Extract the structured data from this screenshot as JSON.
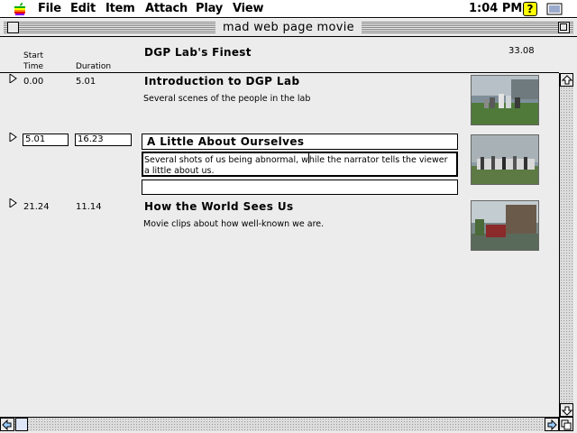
{
  "menubar": {
    "items": [
      "File",
      "Edit",
      "Item",
      "Attach",
      "Play",
      "View"
    ],
    "clock": "1:04 PM",
    "help_icon": "?"
  },
  "window": {
    "title": "mad web page movie"
  },
  "header": {
    "start_label": "Start\nTime",
    "duration_label": "Duration",
    "movie_title": "DGP Lab's Finest",
    "movie_length": "33.08"
  },
  "scenes": [
    {
      "start": "0.00",
      "duration": "5.01",
      "title": "Introduction to DGP Lab",
      "description": "Several scenes of the people in the lab"
    },
    {
      "start": "5.01",
      "duration": "16.23",
      "title": "A Little About Ourselves",
      "description_before_cursor": "Several shots of us being abnormal, w",
      "description_after_cursor": "hile the narrator tells the viewer a little about us.",
      "extra_field": ""
    },
    {
      "start": "21.24",
      "duration": "11.14",
      "title": "How the World Sees Us",
      "description": "Movie clips about how well-known we are."
    }
  ]
}
